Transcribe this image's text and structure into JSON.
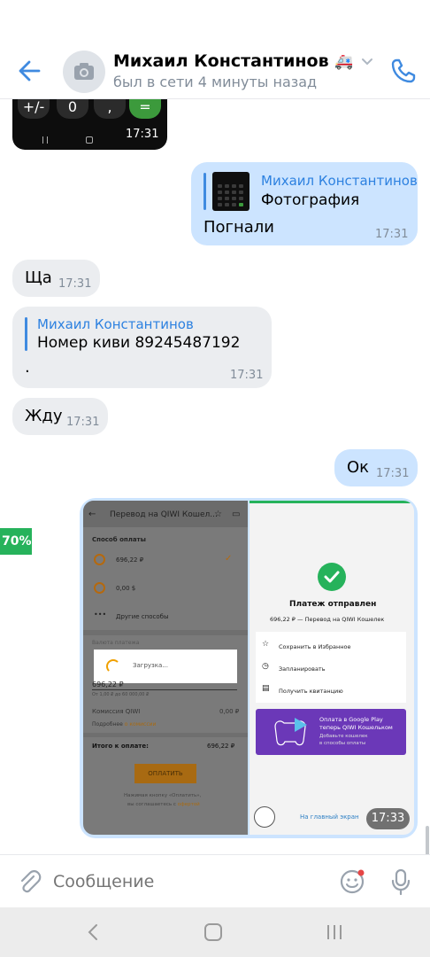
{
  "header": {
    "name": "Михаил Константинов",
    "status": "был в сети 4 минуты назад"
  },
  "top_photo": {
    "keys": [
      "+/-",
      "0",
      ",",
      "="
    ],
    "time": "17:31"
  },
  "messages": [
    {
      "dir": "out",
      "reply_name": "Михаил Константинов",
      "reply_text": "Фотография",
      "text": "Погнали",
      "time": "17:31"
    },
    {
      "dir": "in",
      "text": "Ща",
      "time": "17:31"
    },
    {
      "dir": "in",
      "reply_name": "Михаил Константинов",
      "reply_text": "Номер киви 89245487192",
      "text": ".",
      "time": "17:31"
    },
    {
      "dir": "in",
      "text": "Жду",
      "time": "17:31"
    },
    {
      "dir": "out",
      "text": "Ок",
      "time": "17:31"
    }
  ],
  "attachment": {
    "time": "17:33",
    "progress_label": "70%",
    "left": {
      "title": "Перевод на QIWI Кошел...",
      "section": "Способ оплаты",
      "option1": "696,22 ₽",
      "option2": "0,00 $",
      "option3": "Другие способы",
      "currency": "Валюта платежа",
      "loading": "Загрузка...",
      "amount": "696,22 ₽",
      "range": "От 1,00 ₽ до 60 000,00 ₽",
      "fee_label": "Комиссия QIWI",
      "fee_value": "0,00 ₽",
      "details": "Подробнее",
      "details_link": "о комиссии",
      "total_label": "Итого к оплате:",
      "total_value": "696,22 ₽",
      "pay": "ОПЛАТИТЬ",
      "terms1": "Нажимая кнопку «Оплатить»,",
      "terms2": "вы соглашаетесь с",
      "terms_link": "офертой"
    },
    "right": {
      "title": "Платеж отправлен",
      "subtitle": "696,22 ₽ — Перевод на QIWI Кошелек",
      "action1": "Сохранить в Избранное",
      "action2": "Запланировать",
      "action3": "Получить квитанцию",
      "promo1": "Оплата в Google Play",
      "promo2": "теперь QIWI Кошельком",
      "promo3": "Добавьте кошелек",
      "promo4": "в способы оплаты",
      "home": "На главный экран"
    }
  },
  "input": {
    "placeholder": "Сообщение"
  },
  "colors": {
    "accent": "#3f8ae0",
    "incoming": "#ebedf0",
    "outgoing": "#cce4ff",
    "success": "#26b25b",
    "qiwi_orange": "#ff8c00"
  }
}
